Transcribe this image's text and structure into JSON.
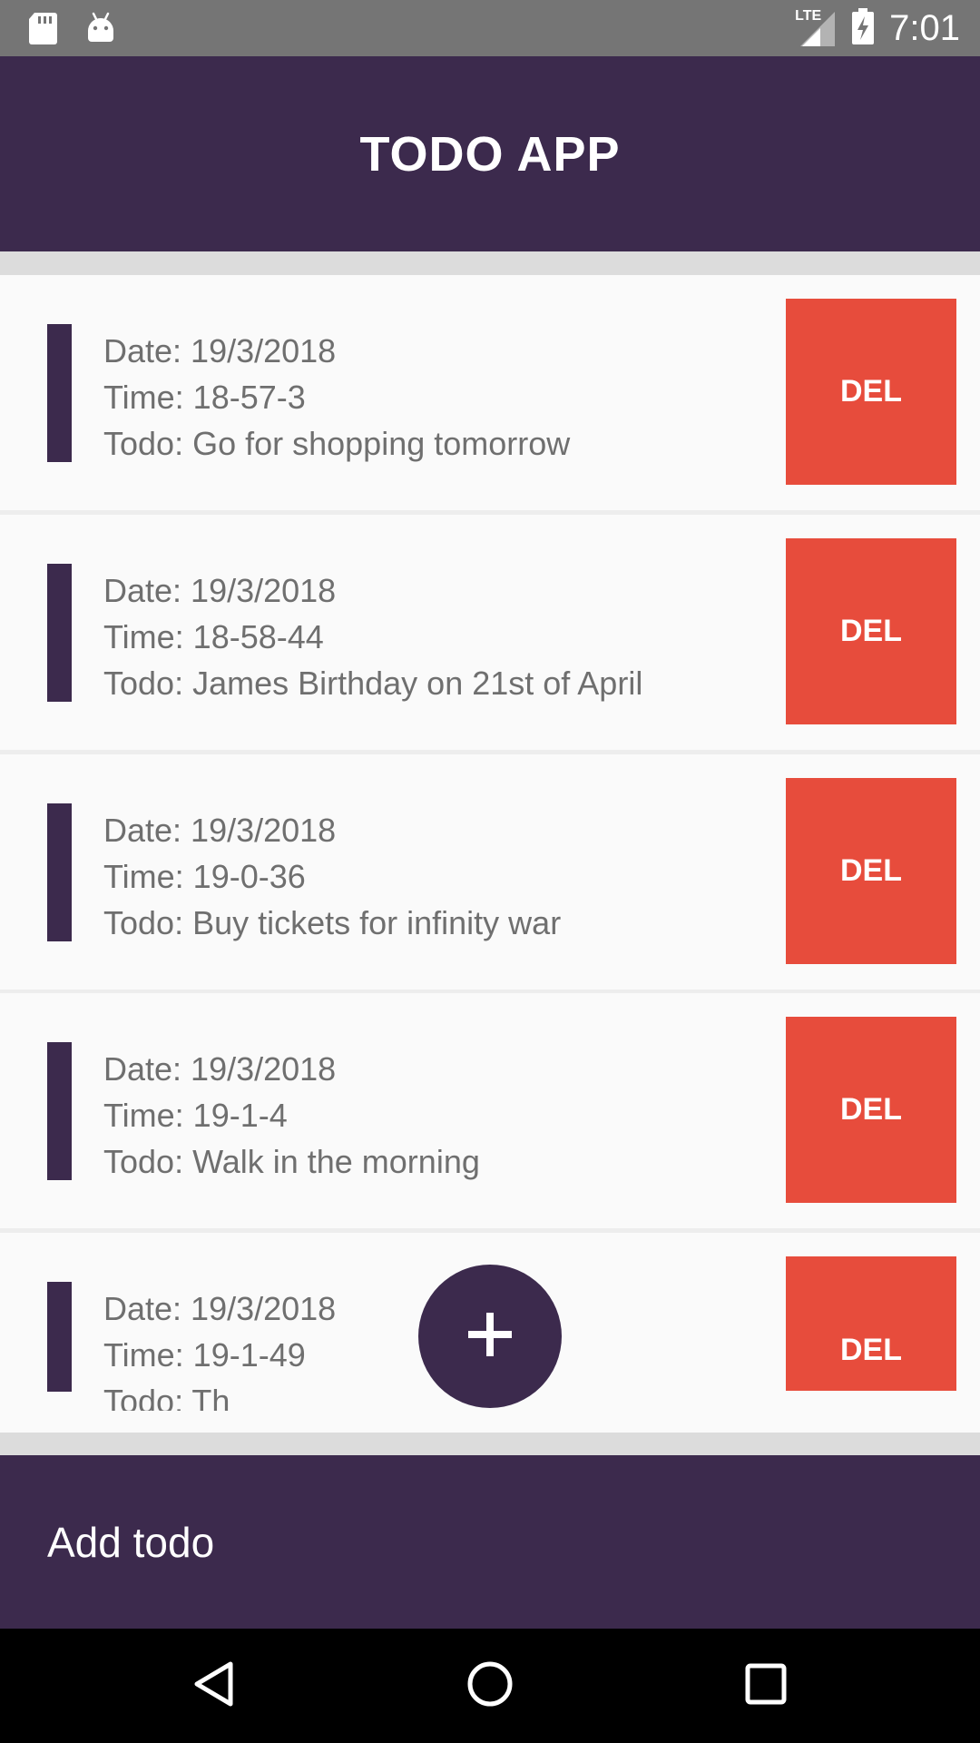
{
  "status_bar": {
    "time": "7:01",
    "network_label": "LTE",
    "icons": [
      "sd-card-icon",
      "android-icon",
      "signal-icon",
      "battery-charging-icon"
    ]
  },
  "app_bar": {
    "title": "TODO APP"
  },
  "todos": [
    {
      "date": "Date: 19/3/2018",
      "time": "Time: 18-57-3",
      "todo": "Todo: Go for shopping tomorrow",
      "delete_label": "DEL"
    },
    {
      "date": "Date: 19/3/2018",
      "time": "Time: 18-58-44",
      "todo": "Todo: James Birthday on 21st of April",
      "delete_label": "DEL"
    },
    {
      "date": "Date: 19/3/2018",
      "time": "Time: 19-0-36",
      "todo": "Todo: Buy tickets for infinity war",
      "delete_label": "DEL"
    },
    {
      "date": "Date: 19/3/2018",
      "time": "Time: 19-1-4",
      "todo": "Todo: Walk in the morning",
      "delete_label": "DEL"
    },
    {
      "date": "Date: 19/3/2018",
      "time": "Time: 19-1-49",
      "todo": "Todo: Th",
      "delete_label": "DEL"
    }
  ],
  "fab": {
    "icon": "plus-icon"
  },
  "add_bar": {
    "label": "Add todo"
  },
  "nav_bar": {
    "icons": [
      "back-icon",
      "home-icon",
      "recents-icon"
    ]
  },
  "colors": {
    "primary": "#3c2a4d",
    "delete": "#e74c3c",
    "status_bar": "#757575",
    "text_secondary": "#6f6f6f"
  }
}
